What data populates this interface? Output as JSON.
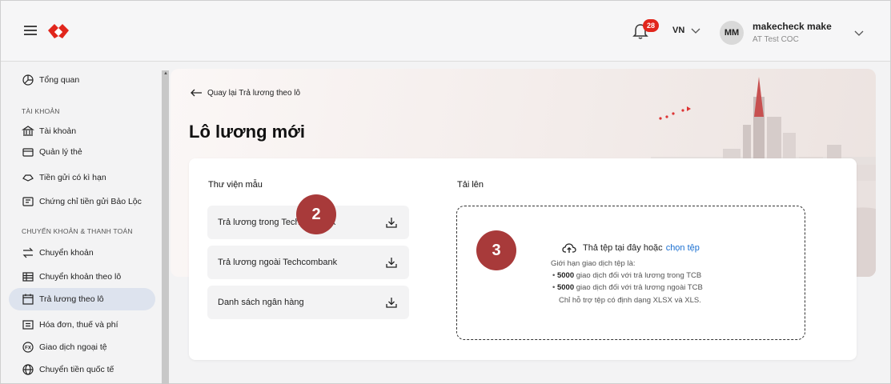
{
  "header": {
    "notification_count": "28",
    "language": "VN",
    "user_initials": "MM",
    "user_name": "makecheck make",
    "user_org": "AT Test COC",
    "brand_color": "#e1261c"
  },
  "sidebar": {
    "items": [
      {
        "label": "Tổng quan",
        "icon": "pie-chart-icon"
      },
      {
        "label": "Tài khoản",
        "icon": "bank-icon"
      },
      {
        "label": "Quản lý thẻ",
        "icon": "card-icon"
      },
      {
        "label": "Tiền gửi có kì hạn",
        "icon": "deposit-icon"
      },
      {
        "label": "Chứng chỉ tiền gửi Bảo Lộc",
        "icon": "certificate-icon"
      },
      {
        "label": "Chuyển khoản",
        "icon": "transfer-icon"
      },
      {
        "label": "Chuyển khoản theo lô",
        "icon": "batch-icon"
      },
      {
        "label": "Trả lương theo lô",
        "icon": "calendar-icon"
      },
      {
        "label": "Hóa đơn, thuế và phí",
        "icon": "bill-icon"
      },
      {
        "label": "Giao dịch ngoại tệ",
        "icon": "fx-icon"
      },
      {
        "label": "Chuyển tiền quốc tế",
        "icon": "globe-icon"
      }
    ],
    "sections": [
      "TÀI KHOẢN",
      "CHUYỂN KHOẢN & THANH TOÁN"
    ],
    "active_color": "#dde3ee"
  },
  "main": {
    "back_label": "Quay lại Trả lương theo lô",
    "title": "Lô lương mới",
    "library": {
      "title": "Thư viện mẫu",
      "templates": [
        "Trả lương trong Techcombank",
        "Trả lương ngoài Techcombank",
        "Danh sách ngân hàng"
      ]
    },
    "upload": {
      "title": "Tải lên",
      "drop_text": "Thả tệp tại đây hoặc",
      "choose_link": "chọn tệp",
      "limit_title": "Giới hạn giao dịch tệp là:",
      "limit_1_count": "5000",
      "limit_1_text": "giao dịch đối với trả lương trong TCB",
      "limit_2_count": "5000",
      "limit_2_text": "giao dịch đối với trả lương ngoài TCB",
      "format_note": "Chỉ hỗ trợ tệp có định dạng XLSX và XLS.",
      "link_color": "#1a6fd1"
    }
  },
  "steps": [
    "2",
    "3"
  ],
  "step_color": "#a83a3a"
}
